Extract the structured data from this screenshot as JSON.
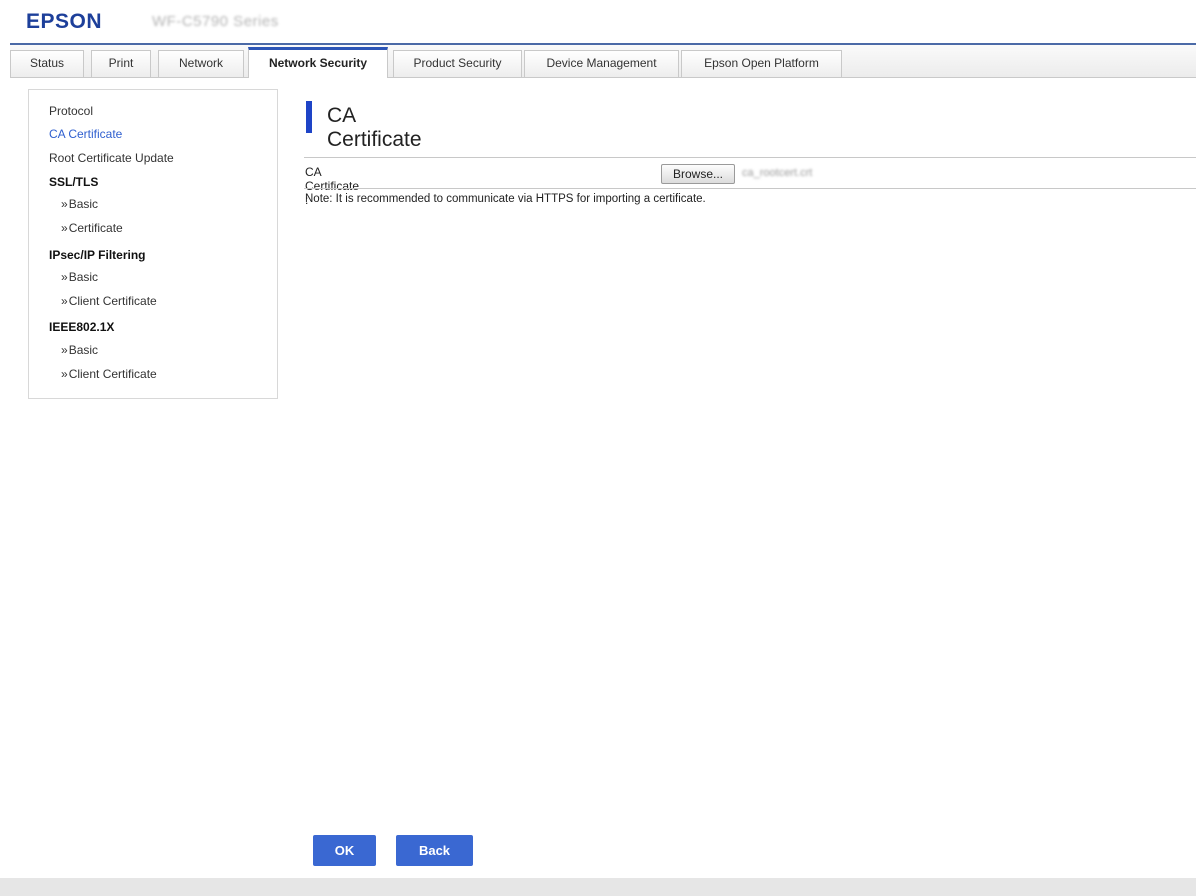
{
  "header": {
    "logo": "EPSON",
    "model": "WF-C5790 Series"
  },
  "tabs": [
    {
      "label": "Status"
    },
    {
      "label": "Print"
    },
    {
      "label": "Network"
    },
    {
      "label": "Network Security",
      "active": true
    },
    {
      "label": "Product Security"
    },
    {
      "label": "Device Management"
    },
    {
      "label": "Epson Open Platform"
    }
  ],
  "sidebar": {
    "protocol": "Protocol",
    "ca_certificate": "CA Certificate",
    "root_cert_update": "Root Certificate Update",
    "ssl_tls": "SSL/TLS",
    "ssl_basic": "Basic",
    "ssl_certificate": "Certificate",
    "ipsec": "IPsec/IP Filtering",
    "ipsec_basic": "Basic",
    "ipsec_client_cert": "Client Certificate",
    "ieee": "IEEE802.1X",
    "ieee_basic": "Basic",
    "ieee_client_cert": "Client Certificate",
    "bullet": "»"
  },
  "main": {
    "title": "CA Certificate",
    "field_label": "CA Certificate :",
    "browse_label": "Browse...",
    "file_name": "ca_rootcert.crt",
    "note": "Note: It is recommended to communicate via HTTPS for importing a certificate."
  },
  "buttons": {
    "ok": "OK",
    "back": "Back"
  },
  "colors": {
    "brand": "#1d3f9a",
    "accent": "#2c55b6",
    "title_bar": "#1e44c7",
    "button": "#3a68d2",
    "active_link": "#2f5fcf"
  }
}
